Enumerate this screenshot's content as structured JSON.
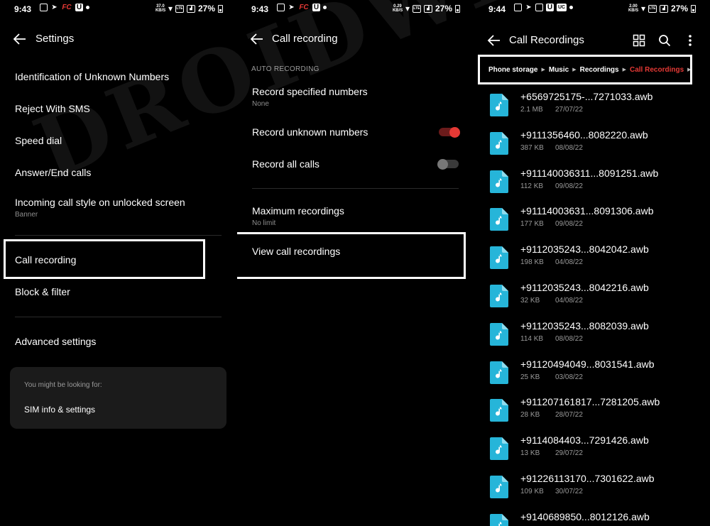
{
  "watermark": "DROIDWIN.COM",
  "colors": {
    "accent": "#e53935",
    "file_icon": "#26b5d9"
  },
  "panel1": {
    "status": {
      "time": "9:43",
      "speed": "37.0 KB/S",
      "battery": "27%"
    },
    "title": "Settings",
    "items": [
      {
        "label": "Identification of Unknown Numbers"
      },
      {
        "label": "Reject With SMS"
      },
      {
        "label": "Speed dial"
      },
      {
        "label": "Answer/End calls"
      },
      {
        "label": "Incoming call style on unlocked screen",
        "sub": "Banner"
      },
      {
        "label": "Call recording"
      },
      {
        "label": "Block & filter"
      },
      {
        "label": "Advanced settings"
      }
    ],
    "suggest": {
      "hint": "You might be looking for:",
      "link": "SIM info & settings"
    }
  },
  "panel2": {
    "status": {
      "time": "9:43",
      "speed": "0.29 KB/S",
      "battery": "27%"
    },
    "title": "Call recording",
    "section": "AUTO RECORDING",
    "items": [
      {
        "label": "Record specified numbers",
        "sub": "None"
      },
      {
        "label": "Record unknown numbers",
        "toggle": "on"
      },
      {
        "label": "Record all calls",
        "toggle": "off"
      },
      {
        "label": "Maximum recordings",
        "sub": "No limit"
      },
      {
        "label": "View call recordings"
      }
    ]
  },
  "panel3": {
    "status": {
      "time": "9:44",
      "speed": "2.00 KB/S",
      "battery": "27%"
    },
    "title": "Call Recordings",
    "icons": [
      "grid-view-icon",
      "search-icon",
      "more-vert-icon"
    ],
    "breadcrumb": [
      "Phone storage",
      "Music",
      "Recordings",
      "Call Recordings"
    ],
    "files": [
      {
        "name": "+6569725175-...7271033.awb",
        "size": "2.1 MB",
        "date": "27/07/22"
      },
      {
        "name": "+9111356460...8082220.awb",
        "size": "387 KB",
        "date": "08/08/22"
      },
      {
        "name": "+911140036311...8091251.awb",
        "size": "112 KB",
        "date": "09/08/22"
      },
      {
        "name": "+91114003631...8091306.awb",
        "size": "177 KB",
        "date": "09/08/22"
      },
      {
        "name": "+9112035243...8042042.awb",
        "size": "198 KB",
        "date": "04/08/22"
      },
      {
        "name": "+9112035243...8042216.awb",
        "size": "32 KB",
        "date": "04/08/22"
      },
      {
        "name": "+9112035243...8082039.awb",
        "size": "114 KB",
        "date": "08/08/22"
      },
      {
        "name": "+91120494049...8031541.awb",
        "size": "25 KB",
        "date": "03/08/22"
      },
      {
        "name": "+911207161817...7281205.awb",
        "size": "28 KB",
        "date": "28/07/22"
      },
      {
        "name": "+9114084403...7291426.awb",
        "size": "13 KB",
        "date": "29/07/22"
      },
      {
        "name": "+91226113170...7301622.awb",
        "size": "109 KB",
        "date": "30/07/22"
      },
      {
        "name": "+9140689850...8012126.awb",
        "size": "",
        "date": ""
      }
    ]
  }
}
